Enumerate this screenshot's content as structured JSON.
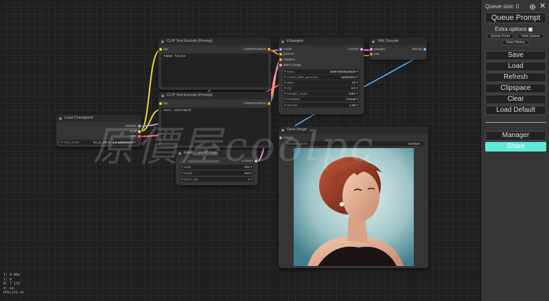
{
  "queue": {
    "size_label": "Queue size: 0"
  },
  "menu": {
    "queue_prompt": "Queue Prompt",
    "extra_options": "Extra options",
    "queue_front": "Queue Front",
    "view_queue": "View Queue",
    "view_history": "View History",
    "save": "Save",
    "load": "Load",
    "refresh": "Refresh",
    "clipspace": "Clipspace",
    "clear": "Clear",
    "load_default": "Load Default",
    "manager": "Manager",
    "share": "Share"
  },
  "nodes": {
    "clip_pos": {
      "title": "CLIP Text Encode (Prompt)",
      "in_clip": "clip",
      "out": "CONDITIONING",
      "text": "femme fatale"
    },
    "clip_neg": {
      "title": "CLIP Text Encode (Prompt)",
      "in_clip": "clip",
      "out": "CONDITIONING",
      "text": "text, watermark"
    },
    "ksampler": {
      "title": "KSampler",
      "in_model": "model",
      "in_positive": "positive",
      "in_negative": "negative",
      "in_latent": "latent_image",
      "out": "LATENT",
      "w_seed_l": "seed",
      "w_seed_v": "356873849626529",
      "w_cag_l": "control_after_generate",
      "w_cag_v": "randomize",
      "w_steps_l": "steps",
      "w_steps_v": "20",
      "w_cfg_l": "cfg",
      "w_cfg_v": "8.0",
      "w_sampler_l": "sampler_name",
      "w_sampler_v": "euler",
      "w_sched_l": "scheduler",
      "w_sched_v": "normal",
      "w_denoise_l": "denoise",
      "w_denoise_v": "1.00"
    },
    "vae_decode": {
      "title": "VAE Decode",
      "in_samples": "samples",
      "in_vae": "vae",
      "out": "IMAGE"
    },
    "checkpoint": {
      "title": "Load Checkpoint",
      "out_model": "MODEL",
      "out_clip": "CLIP",
      "out_vae": "VAE",
      "w_ckpt_l": "ckpt_name",
      "w_ckpt_v": "sd_xl_refiner_1.0.safetensors"
    },
    "empty_latent": {
      "title": "Empty Latent Image",
      "out": "LATENT",
      "w_width_l": "width",
      "w_width_v": "512",
      "w_height_l": "height",
      "w_height_v": "512",
      "w_batch_l": "batch_size",
      "w_batch_v": "1"
    },
    "save_image": {
      "title": "Save Image",
      "in_images": "images",
      "w_prefix_l": "filename_prefix",
      "w_prefix_v": "ComfyUI"
    }
  },
  "watermark": "原價屋coolpc",
  "stats": {
    "t": "T: 0.00s",
    "i": "I: 0",
    "n": "N: 7 [7]",
    "v": "V: 14",
    "fps": "FPS:172.41"
  },
  "colors": {
    "clip": "#f5d742",
    "model": "#b39ddb",
    "vae": "#ff6e6e",
    "latent": "#ff9cf9",
    "conditioning": "#ffa931",
    "image": "#64b5f6",
    "share": "#5ee8d8"
  }
}
